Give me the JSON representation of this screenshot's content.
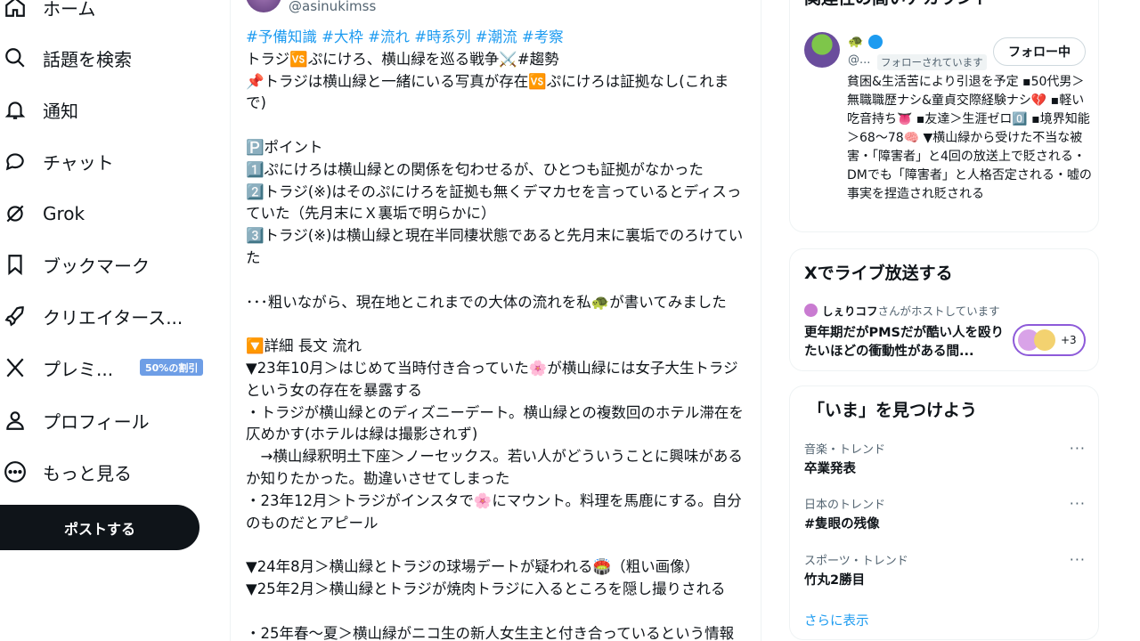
{
  "nav": {
    "items": [
      {
        "label": "ホーム",
        "icon": "home-icon"
      },
      {
        "label": "話題を検索",
        "icon": "search-icon"
      },
      {
        "label": "通知",
        "icon": "bell-icon"
      },
      {
        "label": "チャット",
        "icon": "chat-icon"
      },
      {
        "label": "Grok",
        "icon": "grok-icon"
      },
      {
        "label": "ブックマーク",
        "icon": "bookmark-icon"
      },
      {
        "label": "クリエイタース...",
        "icon": "rocket-icon"
      },
      {
        "label": "プレミ...",
        "icon": "x-logo-icon"
      },
      {
        "label": "プロフィール",
        "icon": "person-icon"
      },
      {
        "label": "もっと見る",
        "icon": "more-circle-icon"
      }
    ],
    "premium_badge": "50%の割引",
    "post_button": "ポストする"
  },
  "post": {
    "handle": "@asinukimss",
    "lines": [
      {
        "text": "#予備知識 #大枠 #流れ #時系列 #潮流 #考察",
        "tag": true
      },
      {
        "text": "トラジ🆚ぷにけろ、横山緑を巡る戦争⚔️#趨勢"
      },
      {
        "text": "📌トラジは横山緑と一緒にいる写真が存在🆚ぷにけろは証拠なし(これまで)"
      },
      {
        "text": ""
      },
      {
        "text": "🅿️ポイント"
      },
      {
        "text": "1️⃣ぷにけろは横山緑との関係を匂わせるが、ひとつも証拠がなかった"
      },
      {
        "text": "2️⃣トラジ(※)はそのぷにけろを証拠も無くデマカセを言っているとディスっていた（先月末にＸ裏垢で明らかに）"
      },
      {
        "text": "3️⃣トラジ(※)は横山緑と現在半同棲状態であると先月末に裏垢でのろけていた"
      },
      {
        "text": ""
      },
      {
        "text": "･･･粗いながら、現在地とこれまでの大体の流れを私🐢が書いてみました"
      },
      {
        "text": ""
      },
      {
        "text": "🔽詳細 長文 流れ"
      },
      {
        "text": "▼23年10月＞はじめて当時付き合っていた🌸が横山緑には女子大生トラジという女の存在を暴露する"
      },
      {
        "text": "・トラジが横山緑とのディズニーデート。横山緑との複数回のホテル滞在を仄めかす(ホテルは緑は撮影されず)"
      },
      {
        "text": "　→横山緑釈明土下座＞ノーセックス。若い人がどういうことに興味があるか知りたかった。勘違いさせてしまった"
      },
      {
        "text": "・23年12月＞トラジがインスタで🌸にマウント。料理を馬鹿にする。自分のものだとアピール"
      },
      {
        "text": ""
      },
      {
        "text": "▼24年8月＞横山緑とトラジの球場デートが疑われる🏟️（粗い画像）"
      },
      {
        "text": "▼25年2月＞横山緑とトラジが焼肉トラジに入るところを隠し撮りされる"
      },
      {
        "text": ""
      },
      {
        "text": "・25年春～夏＞横山緑がニコ生の新人女生主と付き合っているという情報"
      }
    ]
  },
  "related": {
    "title": "関連性の高いアカウント",
    "emoji": "🐢",
    "handle": "@...",
    "follows_you": "フォローされています",
    "follow_button": "フォロー中",
    "bio": "貧困&生活苦により引退を予定 ▪50代男＞無職職歴ナシ&童貞交際経験ナシ💔 ▪軽い吃音持ち👅 ▪友達＞生涯ゼロ0️⃣ ▪境界知能＞68～78🧠 ▼横山緑から受けた不当な被害・「障害者」と4回の放送上で貶される・DMでも「障害者」と人格否定される・嘘の事実を捏造され貶される"
  },
  "live": {
    "title": "Xでライブ放送する",
    "host_name": "しぇりコフ",
    "host_suffix": "さんがホストしています",
    "description": "更年期だがPMSだが酷い人を殴りたいほどの衝動性がある間...",
    "count": "+3"
  },
  "now": {
    "title": "「いま」を見つけよう",
    "trends": [
      {
        "category": "音楽・トレンド",
        "name": "卒業発表"
      },
      {
        "category": "日本のトレンド",
        "name": "#隻眼の残像"
      },
      {
        "category": "スポーツ・トレンド",
        "name": "竹丸2勝目"
      }
    ],
    "more_glyph": "···",
    "show_more": "さらに表示"
  }
}
